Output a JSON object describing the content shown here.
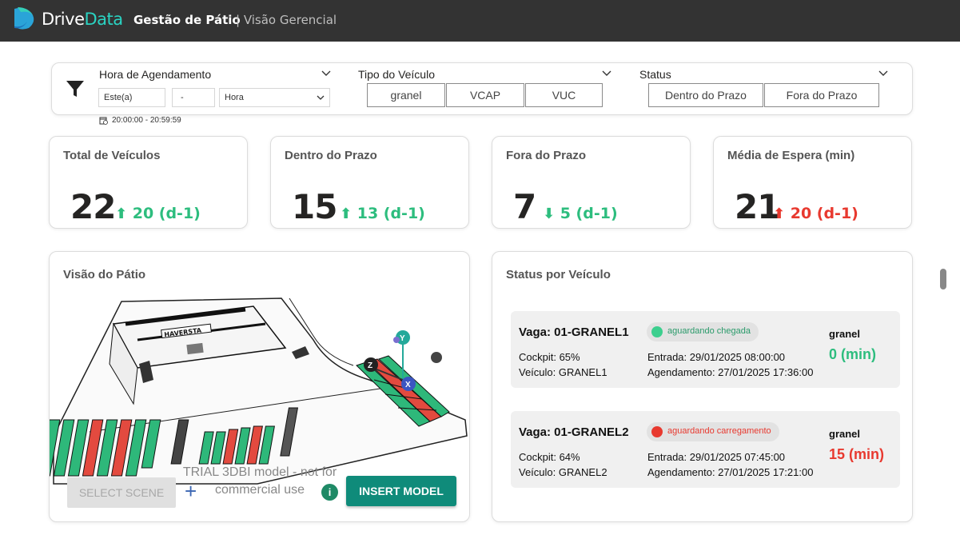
{
  "header": {
    "logo_prefix": "Drive",
    "logo_suffix": "Data",
    "title": "Gestão de Pátio",
    "subtitle": "| Visão Gerencial"
  },
  "filters": {
    "schedule": {
      "label": "Hora de Agendamento",
      "period": "Este(a)",
      "count": "-",
      "unit": "Hora",
      "range": "20:00:00 - 20:59:59"
    },
    "vehicle_type": {
      "label": "Tipo do Veículo",
      "options": [
        "granel",
        "VCAP",
        "VUC"
      ]
    },
    "status": {
      "label": "Status",
      "options": [
        "Dentro do Prazo",
        "Fora do Prazo"
      ]
    }
  },
  "kpis": [
    {
      "title": "Total de Veículos",
      "value": "22",
      "arrow": "⬆",
      "delta": "20 (d-1)",
      "color": "#2dbd7e"
    },
    {
      "title": "Dentro do Prazo",
      "value": "15",
      "arrow": "⬆",
      "delta": "13 (d-1)",
      "color": "#2dbd7e"
    },
    {
      "title": "Fora do Prazo",
      "value": "7",
      "arrow": "⬇",
      "delta": "5 (d-1)",
      "color": "#2dbd7e"
    },
    {
      "title": "Média de Espera (min)",
      "value": "21",
      "arrow": "⬆",
      "delta": "20 (d-1)",
      "color": "#e8392f"
    }
  ],
  "yard": {
    "title": "Visão do Pátio",
    "building_sign": "HAVERSTA",
    "select_scene": "SELECT SCENE",
    "trial_text": "TRIAL 3DBI model - not for commercial use",
    "insert_model": "INSERT MODEL",
    "gizmo_labels": [
      "Y",
      "X",
      "Z"
    ]
  },
  "vehicles_panel": {
    "title": "Status por Veículo",
    "items": [
      {
        "vaga": "Vaga: 01-GRANEL1",
        "status": "aguardando chegada",
        "status_color": "#3ccf8e",
        "status_text_color": "#2a9a6a",
        "type": "granel",
        "cockpit": "Cockpit: 65%",
        "veiculo": "Veículo: GRANEL1",
        "entrada": "Entrada: 29/01/2025 08:00:00",
        "agendamento": "Agendamento: 27/01/2025 17:36:00",
        "wait": "0 (min)",
        "wait_color": "#2dbd7e"
      },
      {
        "vaga": "Vaga: 01-GRANEL2",
        "status": "aguardando carregamento",
        "status_color": "#e8392f",
        "status_text_color": "#e8392f",
        "type": "granel",
        "cockpit": "Cockpit: 64%",
        "veiculo": "Veículo: GRANEL2",
        "entrada": "Entrada: 29/01/2025 07:45:00",
        "agendamento": "Agendamento: 27/01/2025 17:21:00",
        "wait": "15 (min)",
        "wait_color": "#e8392f"
      }
    ]
  }
}
